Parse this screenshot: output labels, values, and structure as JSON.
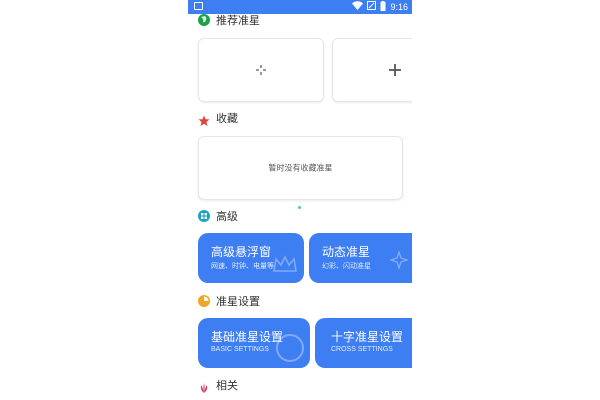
{
  "status_bar": {
    "time": "9:16",
    "icons": [
      "image-notification-icon",
      "wifi-icon",
      "signal-icon",
      "battery-icon"
    ]
  },
  "sections": {
    "recommended": {
      "title": "推荐准星",
      "icon": "globe-icon",
      "icon_color": "#1aa24b"
    },
    "favorites": {
      "title": "收藏",
      "icon": "star-icon",
      "icon_color": "#e0453a",
      "empty_text": "暂时没有收藏准星"
    },
    "advanced": {
      "title": "高级",
      "icon": "grid-circle-icon",
      "icon_color": "#1aa6b8",
      "cards": [
        {
          "title": "高级悬浮窗",
          "subtitle": "网速、时钟、电量等"
        },
        {
          "title": "动态准星",
          "subtitle": "幻彩、闪动准星"
        }
      ]
    },
    "crosshair_settings": {
      "title": "准星设置",
      "icon": "pie-icon",
      "icon_color": "#f2a526",
      "cards": [
        {
          "title": "基础准星设置",
          "subtitle": "BASIC SETTINGS"
        },
        {
          "title": "十字准星设置",
          "subtitle": "CROSS SETTINGS"
        }
      ]
    },
    "related": {
      "title": "相关",
      "icon": "lotus-icon",
      "icon_color": "#d6336c"
    }
  },
  "colors": {
    "accent": "#3e7ef3",
    "status_bar": "#3e7ef3"
  }
}
